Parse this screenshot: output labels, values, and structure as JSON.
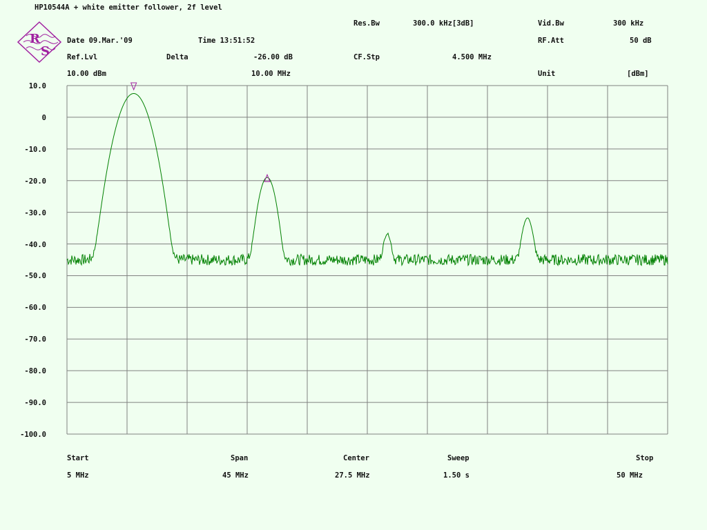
{
  "header": {
    "title": "HP10544A + white emitter follower, 2f level",
    "res_bw_label": "Res.Bw",
    "res_bw_value": "300.0 kHz[3dB]",
    "vid_bw_label": "Vid.Bw",
    "vid_bw_value": "300 kHz",
    "date": "Date 09.Mar.'09",
    "time": "Time 13:51:52",
    "rf_att_label": "RF.Att",
    "rf_att_value": "50 dB",
    "ref_lvl_label": "Ref.Lvl",
    "ref_lvl_value": "10.00 dBm",
    "delta_label": "Delta",
    "delta_level": "-26.00 dB",
    "delta_freq": "10.00 MHz",
    "cf_stp_label": "CF.Stp",
    "cf_stp_value": "4.500 MHz",
    "unit_label": "Unit",
    "unit_value": "[dBm]"
  },
  "logo": {
    "letters": [
      "R",
      "S"
    ],
    "color": "#a020a0"
  },
  "footer": {
    "start_label": "Start",
    "start_value": "5 MHz",
    "span_label": "Span",
    "span_value": "45 MHz",
    "center_label": "Center",
    "center_value": "27.5 MHz",
    "sweep_label": "Sweep",
    "sweep_value": "1.50 s",
    "stop_label": "Stop",
    "stop_value": "50 MHz"
  },
  "chart_data": {
    "type": "line",
    "xlim": [
      5,
      50
    ],
    "ylim": [
      -100,
      10
    ],
    "y_tick_labels": [
      "10.0",
      "0",
      "-10.0",
      "-20.0",
      "-30.0",
      "-40.0",
      "-50.0",
      "-60.0",
      "-70.0",
      "-80.0",
      "-90.0",
      "-100.0"
    ],
    "grid": true,
    "x_divisions": 10,
    "y_divisions": 11,
    "trace_color": "#008000",
    "grid_color": "#808080",
    "marker_color": "#a020a0",
    "noise_floor": -45,
    "peaks": [
      {
        "x": 10.0,
        "y": 7.5,
        "width": 0.6
      },
      {
        "x": 20.0,
        "y": -19.0,
        "width": 0.35
      },
      {
        "x": 29.0,
        "y": -37.5,
        "width": 0.2
      },
      {
        "x": 39.5,
        "y": -32.0,
        "width": 0.25
      }
    ],
    "markers": [
      {
        "type": "main",
        "x": 10.0,
        "y": 10.0
      },
      {
        "type": "delta",
        "x": 20.0,
        "y": -19.0
      }
    ]
  }
}
